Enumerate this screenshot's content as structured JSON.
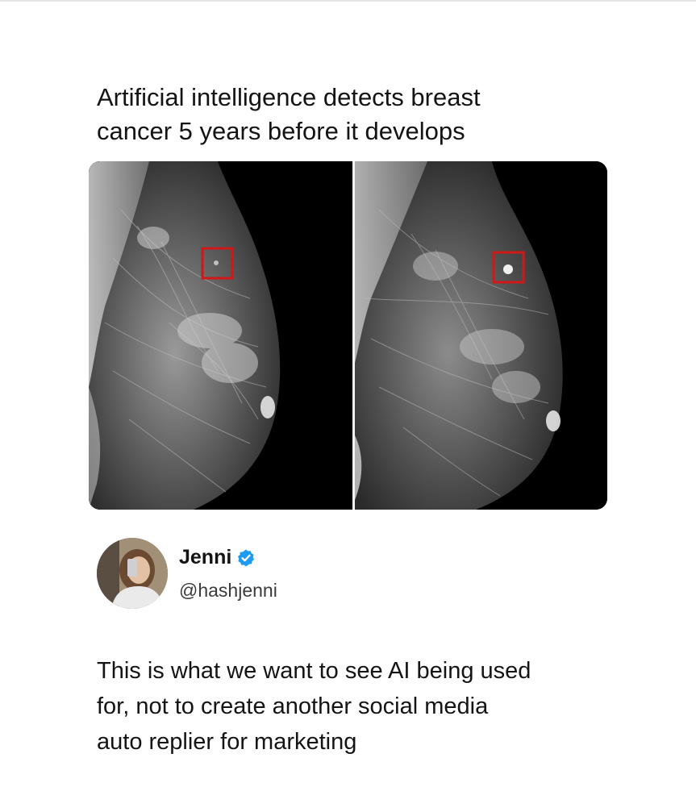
{
  "post": {
    "headline_line1": "Artificial intelligence detects breast",
    "headline_line2": "cancer 5 years before it develops",
    "media": {
      "left_image": "mammogram-earlier",
      "right_image": "mammogram-later",
      "highlight_color": "#d01818"
    },
    "author": {
      "display_name": "Jenni",
      "handle": "@hashjenni",
      "verified": true,
      "verified_color": "#1d9bf0"
    },
    "body_line1": "This is what we want to see AI being used",
    "body_line2": "for, not to create another social media",
    "body_line3": "auto replier for marketing"
  }
}
